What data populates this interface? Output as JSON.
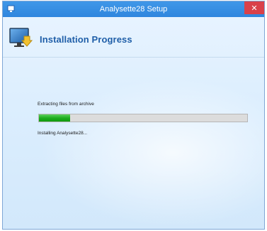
{
  "window": {
    "title": "Analysette28 Setup",
    "close_glyph": "✕"
  },
  "header": {
    "title": "Installation Progress",
    "icon": "computer-monitor-icon"
  },
  "status": {
    "current_action": "Extracting files from archive",
    "progress": 0.15,
    "detail": "Installing Analysette28..."
  },
  "colors": {
    "accent": "#2f86de",
    "progress_fill": "#1fae1f",
    "close_button": "#d9414a",
    "title_text": "#1f5ea8"
  }
}
